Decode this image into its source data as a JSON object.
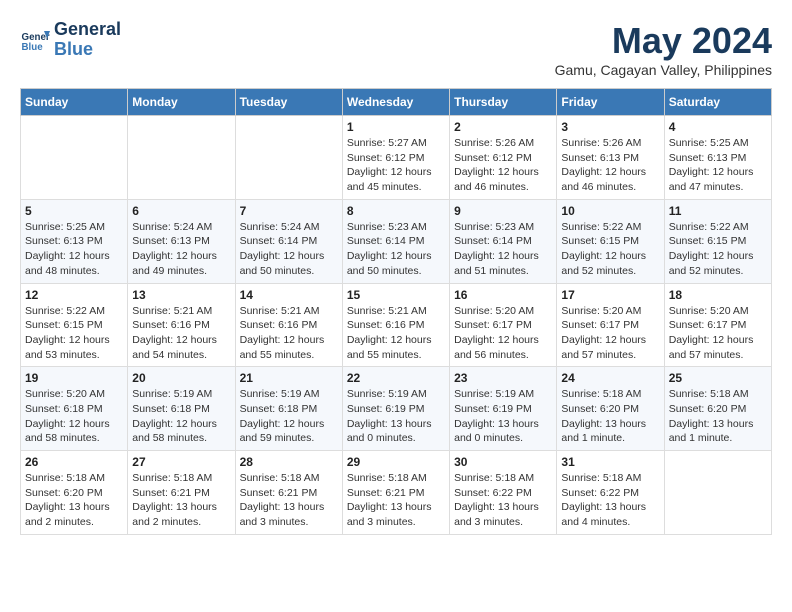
{
  "header": {
    "logo_line1": "General",
    "logo_line2": "Blue",
    "month_year": "May 2024",
    "location": "Gamu, Cagayan Valley, Philippines"
  },
  "weekdays": [
    "Sunday",
    "Monday",
    "Tuesday",
    "Wednesday",
    "Thursday",
    "Friday",
    "Saturday"
  ],
  "weeks": [
    [
      {
        "day": "",
        "info": ""
      },
      {
        "day": "",
        "info": ""
      },
      {
        "day": "",
        "info": ""
      },
      {
        "day": "1",
        "info": "Sunrise: 5:27 AM\nSunset: 6:12 PM\nDaylight: 12 hours\nand 45 minutes."
      },
      {
        "day": "2",
        "info": "Sunrise: 5:26 AM\nSunset: 6:12 PM\nDaylight: 12 hours\nand 46 minutes."
      },
      {
        "day": "3",
        "info": "Sunrise: 5:26 AM\nSunset: 6:13 PM\nDaylight: 12 hours\nand 46 minutes."
      },
      {
        "day": "4",
        "info": "Sunrise: 5:25 AM\nSunset: 6:13 PM\nDaylight: 12 hours\nand 47 minutes."
      }
    ],
    [
      {
        "day": "5",
        "info": "Sunrise: 5:25 AM\nSunset: 6:13 PM\nDaylight: 12 hours\nand 48 minutes."
      },
      {
        "day": "6",
        "info": "Sunrise: 5:24 AM\nSunset: 6:13 PM\nDaylight: 12 hours\nand 49 minutes."
      },
      {
        "day": "7",
        "info": "Sunrise: 5:24 AM\nSunset: 6:14 PM\nDaylight: 12 hours\nand 50 minutes."
      },
      {
        "day": "8",
        "info": "Sunrise: 5:23 AM\nSunset: 6:14 PM\nDaylight: 12 hours\nand 50 minutes."
      },
      {
        "day": "9",
        "info": "Sunrise: 5:23 AM\nSunset: 6:14 PM\nDaylight: 12 hours\nand 51 minutes."
      },
      {
        "day": "10",
        "info": "Sunrise: 5:22 AM\nSunset: 6:15 PM\nDaylight: 12 hours\nand 52 minutes."
      },
      {
        "day": "11",
        "info": "Sunrise: 5:22 AM\nSunset: 6:15 PM\nDaylight: 12 hours\nand 52 minutes."
      }
    ],
    [
      {
        "day": "12",
        "info": "Sunrise: 5:22 AM\nSunset: 6:15 PM\nDaylight: 12 hours\nand 53 minutes."
      },
      {
        "day": "13",
        "info": "Sunrise: 5:21 AM\nSunset: 6:16 PM\nDaylight: 12 hours\nand 54 minutes."
      },
      {
        "day": "14",
        "info": "Sunrise: 5:21 AM\nSunset: 6:16 PM\nDaylight: 12 hours\nand 55 minutes."
      },
      {
        "day": "15",
        "info": "Sunrise: 5:21 AM\nSunset: 6:16 PM\nDaylight: 12 hours\nand 55 minutes."
      },
      {
        "day": "16",
        "info": "Sunrise: 5:20 AM\nSunset: 6:17 PM\nDaylight: 12 hours\nand 56 minutes."
      },
      {
        "day": "17",
        "info": "Sunrise: 5:20 AM\nSunset: 6:17 PM\nDaylight: 12 hours\nand 57 minutes."
      },
      {
        "day": "18",
        "info": "Sunrise: 5:20 AM\nSunset: 6:17 PM\nDaylight: 12 hours\nand 57 minutes."
      }
    ],
    [
      {
        "day": "19",
        "info": "Sunrise: 5:20 AM\nSunset: 6:18 PM\nDaylight: 12 hours\nand 58 minutes."
      },
      {
        "day": "20",
        "info": "Sunrise: 5:19 AM\nSunset: 6:18 PM\nDaylight: 12 hours\nand 58 minutes."
      },
      {
        "day": "21",
        "info": "Sunrise: 5:19 AM\nSunset: 6:18 PM\nDaylight: 12 hours\nand 59 minutes."
      },
      {
        "day": "22",
        "info": "Sunrise: 5:19 AM\nSunset: 6:19 PM\nDaylight: 13 hours\nand 0 minutes."
      },
      {
        "day": "23",
        "info": "Sunrise: 5:19 AM\nSunset: 6:19 PM\nDaylight: 13 hours\nand 0 minutes."
      },
      {
        "day": "24",
        "info": "Sunrise: 5:18 AM\nSunset: 6:20 PM\nDaylight: 13 hours\nand 1 minute."
      },
      {
        "day": "25",
        "info": "Sunrise: 5:18 AM\nSunset: 6:20 PM\nDaylight: 13 hours\nand 1 minute."
      }
    ],
    [
      {
        "day": "26",
        "info": "Sunrise: 5:18 AM\nSunset: 6:20 PM\nDaylight: 13 hours\nand 2 minutes."
      },
      {
        "day": "27",
        "info": "Sunrise: 5:18 AM\nSunset: 6:21 PM\nDaylight: 13 hours\nand 2 minutes."
      },
      {
        "day": "28",
        "info": "Sunrise: 5:18 AM\nSunset: 6:21 PM\nDaylight: 13 hours\nand 3 minutes."
      },
      {
        "day": "29",
        "info": "Sunrise: 5:18 AM\nSunset: 6:21 PM\nDaylight: 13 hours\nand 3 minutes."
      },
      {
        "day": "30",
        "info": "Sunrise: 5:18 AM\nSunset: 6:22 PM\nDaylight: 13 hours\nand 3 minutes."
      },
      {
        "day": "31",
        "info": "Sunrise: 5:18 AM\nSunset: 6:22 PM\nDaylight: 13 hours\nand 4 minutes."
      },
      {
        "day": "",
        "info": ""
      }
    ]
  ]
}
